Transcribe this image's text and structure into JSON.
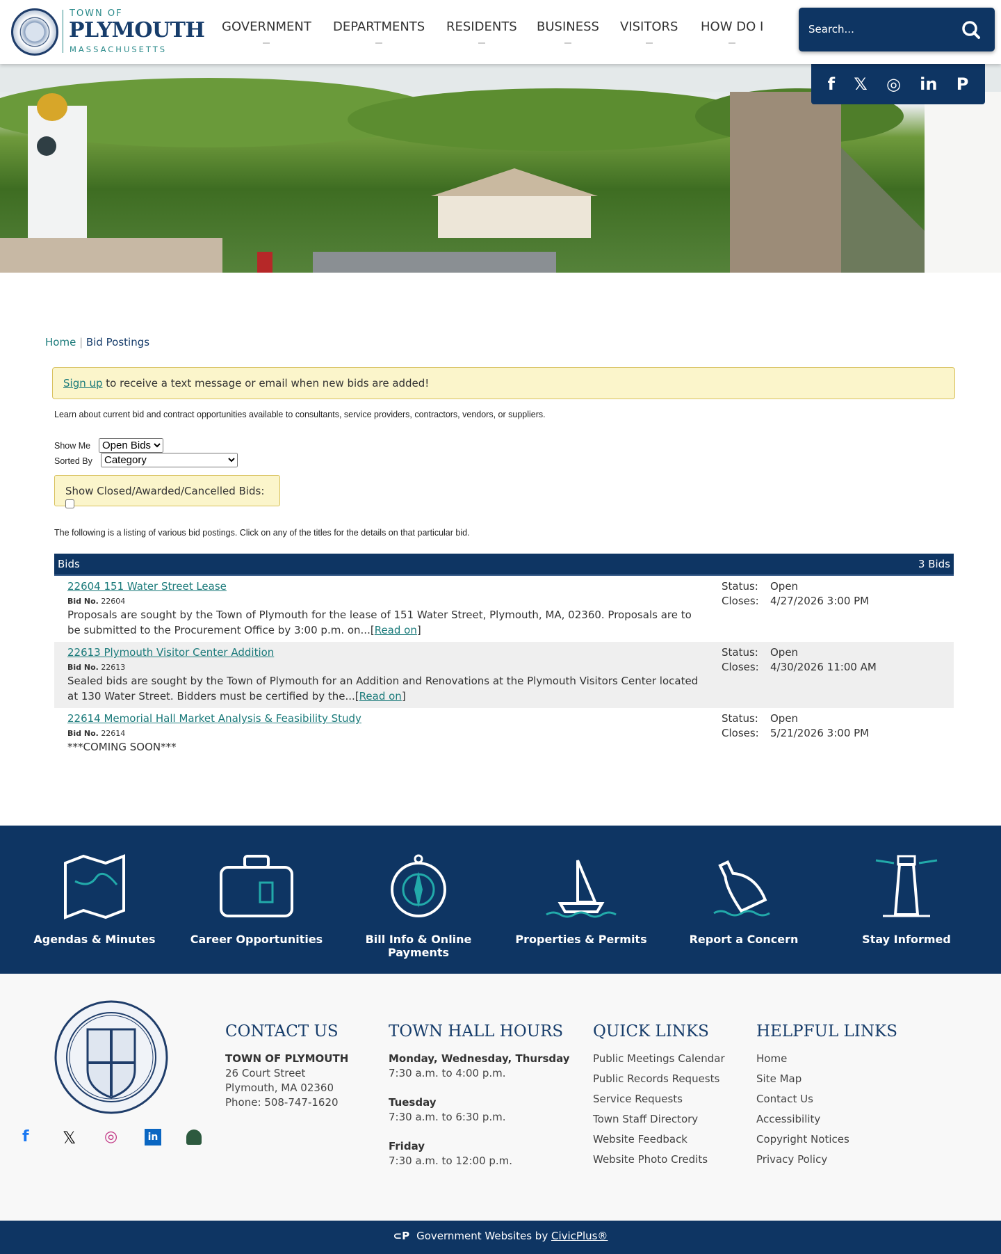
{
  "header": {
    "logo": {
      "top": "TOWN OF",
      "main": "PLYMOUTH",
      "bottom": "MASSACHUSETTS"
    },
    "nav": [
      "GOVERNMENT",
      "DEPARTMENTS",
      "RESIDENTS",
      "BUSINESS",
      "VISITORS",
      "HOW DO I"
    ],
    "search_placeholder": "Search...",
    "social": [
      "facebook",
      "x",
      "instagram",
      "linkedin",
      "plymouth-p"
    ]
  },
  "breadcrumb": {
    "home": "Home",
    "current": "Bid Postings"
  },
  "signup": {
    "link": "Sign up",
    "text": " to receive a text message or email when new bids are added!"
  },
  "intro": "Learn about current bid and contract opportunities available to consultants, service providers, contractors, vendors, or suppliers.",
  "filters": {
    "show_me_label": "Show Me",
    "show_me_value": "Open Bids",
    "sorted_by_label": "Sorted By",
    "sorted_by_value": "Category",
    "closed_label": "Show Closed/Awarded/Cancelled Bids:"
  },
  "listing_note": "The following is a listing of various bid postings. Click on any of the titles for the details on that particular bid.",
  "bids": {
    "header": "Bids",
    "count": "3 Bids",
    "bidno_label": "Bid No.",
    "status_label": "Status:",
    "closes_label": "Closes:",
    "read_on": "Read on",
    "items": [
      {
        "title": "22604 151 Water Street Lease",
        "no": "22604",
        "desc": "Proposals are sought by the Town of Plymouth for the lease of 151 Water Street, Plymouth, MA, 02360. Proposals are to be submitted to the Procurement Office by 3:00 p.m. on...",
        "status": "Open",
        "closes": "4/27/2026 3:00 PM"
      },
      {
        "title": "22613 Plymouth Visitor Center Addition",
        "no": "22613",
        "desc": "Sealed bids are sought by the Town of Plymouth for an Addition and Renovations at the Plymouth Visitors Center located at 130 Water Street. Bidders must be certified by the...",
        "status": "Open",
        "closes": "4/30/2026 11:00 AM"
      },
      {
        "title": "22614 Memorial Hall Market Analysis & Feasibility Study",
        "no": "22614",
        "desc": "***COMING SOON***",
        "status": "Open",
        "closes": "5/21/2026 3:00 PM"
      }
    ]
  },
  "quick_links": [
    "Agendas & Minutes",
    "Career Opportunities",
    "Bill Info & Online Payments",
    "Properties & Permits",
    "Report a Concern",
    "Stay Informed"
  ],
  "footer": {
    "contact": {
      "heading": "CONTACT US",
      "name": "TOWN OF PLYMOUTH",
      "street": "26 Court Street",
      "city": "Plymouth, MA 02360",
      "phone": "Phone: 508-747-1620"
    },
    "hours": {
      "heading": "TOWN HALL HOURS",
      "d1": "Monday, Wednesday, Thursday",
      "h1": "7:30 a.m. to 4:00 p.m.",
      "d2": "Tuesday",
      "h2": "7:30 a.m. to 6:30 p.m.",
      "d3": "Friday",
      "h3": "7:30 a.m. to 12:00 p.m."
    },
    "quick": {
      "heading": "QUICK LINKS",
      "items": [
        "Public Meetings Calendar",
        "Public Records Requests",
        "Service Requests",
        "Town Staff Directory",
        "Website Feedback",
        "Website Photo Credits"
      ]
    },
    "helpful": {
      "heading": "HELPFUL LINKS",
      "items": [
        "Home",
        "Site Map",
        "Contact Us",
        "Accessibility",
        "Copyright Notices",
        "Privacy Policy"
      ]
    }
  },
  "bottom": {
    "text": "Government Websites by ",
    "link": "CivicPlus®"
  },
  "colors": {
    "navy": "#0e3563",
    "teal": "#1a7a7a",
    "notice": "#fbf5cb"
  }
}
